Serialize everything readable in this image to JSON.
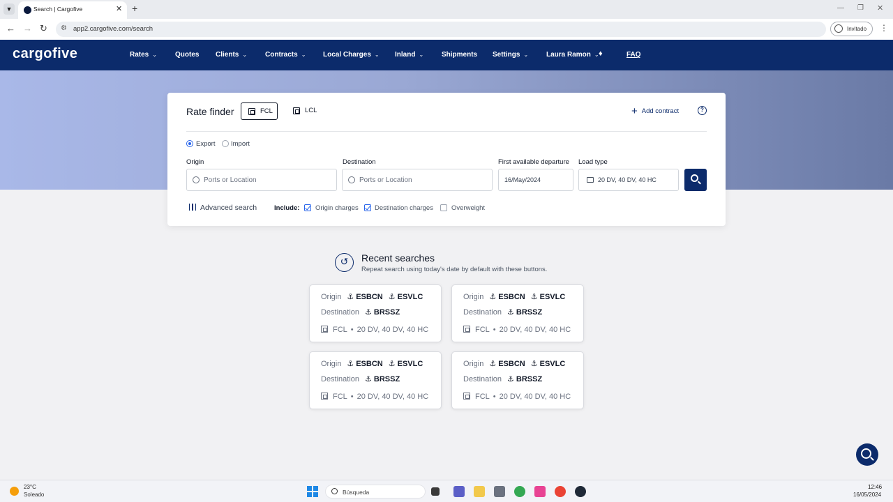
{
  "browser": {
    "tab_title": "Search | Cargofive",
    "url": "app2.cargofive.com/search",
    "profile_label": "Invitado"
  },
  "app": {
    "logo": "cargofive",
    "nav": {
      "rates": "Rates",
      "quotes": "Quotes",
      "clients": "Clients",
      "contracts": "Contracts",
      "local_charges": "Local Charges",
      "inland": "Inland",
      "shipments": "Shipments",
      "settings": "Settings",
      "user": "Laura Ramon",
      "faq": "FAQ"
    }
  },
  "rate_finder": {
    "title": "Rate finder",
    "modes": {
      "fcl": "FCL",
      "lcl": "LCL",
      "selected": "FCL"
    },
    "add_contract": "Add contract",
    "direction": {
      "export": "Export",
      "import": "Import",
      "selected": "Export"
    },
    "origin": {
      "label": "Origin",
      "placeholder": "Ports or Location"
    },
    "destination": {
      "label": "Destination",
      "placeholder": "Ports or Location"
    },
    "departure": {
      "label": "First available departure",
      "value": "16/May/2024"
    },
    "load_type": {
      "label": "Load type",
      "value": "20 DV, 40 DV, 40 HC"
    },
    "advanced_search": "Advanced search",
    "include_label": "Include:",
    "include": {
      "origin_charges": {
        "label": "Origin charges",
        "checked": true
      },
      "destination_charges": {
        "label": "Destination charges",
        "checked": true
      },
      "overweight": {
        "label": "Overweight",
        "checked": false
      }
    }
  },
  "recent": {
    "title": "Recent searches",
    "subtitle": "Repeat search using today's date by default with these buttons.",
    "origin_label": "Origin",
    "destination_label": "Destination",
    "cards": [
      {
        "origin_ports": [
          "ESBCN",
          "ESVLC"
        ],
        "destination_port": "BRSSZ",
        "mode": "FCL",
        "load": "20 DV, 40 DV, 40 HC"
      },
      {
        "origin_ports": [
          "ESBCN",
          "ESVLC"
        ],
        "destination_port": "BRSSZ",
        "mode": "FCL",
        "load": "20 DV, 40 DV, 40 HC"
      },
      {
        "origin_ports": [
          "ESBCN",
          "ESVLC"
        ],
        "destination_port": "BRSSZ",
        "mode": "FCL",
        "load": "20 DV, 40 DV, 40 HC"
      },
      {
        "origin_ports": [
          "ESBCN",
          "ESVLC"
        ],
        "destination_port": "BRSSZ",
        "mode": "FCL",
        "load": "20 DV, 40 DV, 40 HC"
      }
    ]
  },
  "taskbar": {
    "weather_temp": "23°C",
    "weather_desc": "Soleado",
    "search_placeholder": "Búsqueda",
    "time": "12:46",
    "date": "16/05/2024"
  },
  "colors": {
    "brand_navy": "#0c2b6b",
    "accent_blue": "#2563eb"
  }
}
